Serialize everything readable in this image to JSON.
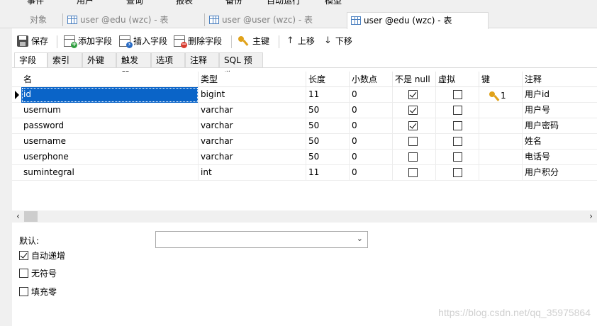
{
  "menubar": {
    "items": [
      "事件",
      "用户",
      "查询",
      "报表",
      "备份",
      "自动运行",
      "模型"
    ]
  },
  "tabs": [
    {
      "label": "对象",
      "icon": "none",
      "active": false
    },
    {
      "label": "user @edu (wzc) - 表",
      "icon": "table-icon",
      "active": false
    },
    {
      "label": "user @user (wzc) - 表",
      "icon": "table-icon",
      "active": false
    },
    {
      "label": "user @edu (wzc) - 表",
      "icon": "table-icon",
      "active": true
    }
  ],
  "toolbar": {
    "save": "保存",
    "add_field": "添加字段",
    "insert_field": "插入字段",
    "delete_field": "删除字段",
    "primary_key": "主键",
    "move_up": "上移",
    "move_down": "下移"
  },
  "subtabs": [
    "字段",
    "索引",
    "外键",
    "触发器",
    "选项",
    "注释",
    "SQL 预览"
  ],
  "grid": {
    "headers": [
      "名",
      "类型",
      "长度",
      "小数点",
      "不是 null",
      "虚拟",
      "键",
      "注释"
    ],
    "rows": [
      {
        "name": "id",
        "type": "bigint",
        "length": "11",
        "decimals": "0",
        "not_null": true,
        "virtual": false,
        "key": "1",
        "comment": "用户id"
      },
      {
        "name": "usernum",
        "type": "varchar",
        "length": "50",
        "decimals": "0",
        "not_null": true,
        "virtual": false,
        "key": "",
        "comment": "用户号"
      },
      {
        "name": "password",
        "type": "varchar",
        "length": "50",
        "decimals": "0",
        "not_null": true,
        "virtual": false,
        "key": "",
        "comment": "用户密码"
      },
      {
        "name": "username",
        "type": "varchar",
        "length": "50",
        "decimals": "0",
        "not_null": false,
        "virtual": false,
        "key": "",
        "comment": "姓名"
      },
      {
        "name": "userphone",
        "type": "varchar",
        "length": "50",
        "decimals": "0",
        "not_null": false,
        "virtual": false,
        "key": "",
        "comment": "电话号"
      },
      {
        "name": "sumintegral",
        "type": "int",
        "length": "11",
        "decimals": "0",
        "not_null": false,
        "virtual": false,
        "key": "",
        "comment": "用户积分"
      }
    ]
  },
  "props": {
    "default_label": "默认:",
    "default_value": "",
    "auto_increment": {
      "label": "自动递增",
      "checked": true
    },
    "unsigned": {
      "label": "无符号",
      "checked": false
    },
    "zerofill": {
      "label": "填充零",
      "checked": false
    }
  },
  "watermark": "https://blog.csdn.net/qq_35975864",
  "colors": {
    "selection": "#0a64c8",
    "key_icon": "#e0a21a",
    "toolbar_bg": "#f0f0f0"
  }
}
